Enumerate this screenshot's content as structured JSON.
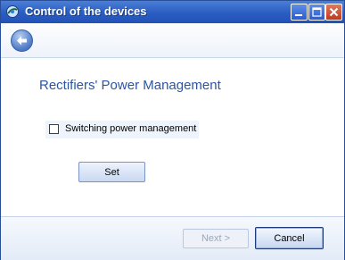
{
  "window": {
    "title": "Control of the devices"
  },
  "page": {
    "heading": "Rectifiers' Power Management"
  },
  "options": {
    "switching_label": "Switching power management",
    "switching_checked": false
  },
  "actions": {
    "set_label": "Set",
    "next_label": "Next >",
    "cancel_label": "Cancel"
  },
  "colors": {
    "titlebar": "#2a5cc2",
    "heading": "#2c55a2"
  }
}
